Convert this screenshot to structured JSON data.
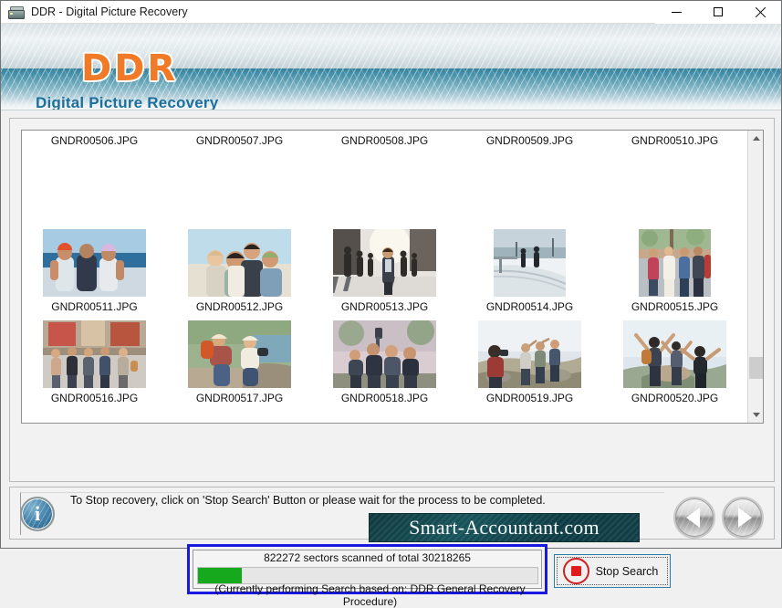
{
  "window": {
    "title": "DDR - Digital Picture Recovery",
    "icon": "drive-icon",
    "minimize_label": "—",
    "maximize_label": "□",
    "close_label": "✕"
  },
  "banner": {
    "logo": "DDR",
    "subtitle": "Digital Picture Recovery",
    "logo_color": "#f07a28",
    "subtitle_color": "#1c6f9c"
  },
  "file_grid": {
    "row1_captions": [
      "GNDR00506.JPG",
      "GNDR00507.JPG",
      "GNDR00508.JPG",
      "GNDR00509.JPG",
      "GNDR00510.JPG"
    ],
    "items": [
      {
        "caption": "GNDR00511.JPG",
        "scene": "beach-friends-backs"
      },
      {
        "caption": "GNDR00512.JPG",
        "scene": "group-selfie-sunny"
      },
      {
        "caption": "GNDR00513.JPG",
        "scene": "city-street-crowd"
      },
      {
        "caption": "GNDR00514.JPG",
        "scene": "snowy-path-walkers"
      },
      {
        "caption": "GNDR00515.JPG",
        "scene": "street-party-group"
      },
      {
        "caption": "GNDR00516.JPG",
        "scene": "friends-walking-town"
      },
      {
        "caption": "GNDR00517.JPG",
        "scene": "hikers-on-rock-lake"
      },
      {
        "caption": "GNDR00518.JPG",
        "scene": "friends-selfie-outdoors"
      },
      {
        "caption": "GNDR00519.JPG",
        "scene": "mountain-photo-group"
      },
      {
        "caption": "GNDR00520.JPG",
        "scene": "summit-arms-raised"
      }
    ],
    "scrollbar": {
      "up_arrow": "chevron-up",
      "down_arrow": "chevron-down",
      "thumb_position_percent": 88
    }
  },
  "progress": {
    "sectors_scanned": 822272,
    "sectors_total": 30218265,
    "label": "822272 sectors scanned of total 30218265",
    "note": "(Currently performing Search based on:  DDR General Recovery Procedure)",
    "percent": 13,
    "fill_color": "#16a91e",
    "border_color": "#1818e0"
  },
  "stop_button": {
    "label": "Stop Search",
    "icon": "stop-square-icon",
    "icon_color": "#e01c1c"
  },
  "status": {
    "icon": "info-icon",
    "message": "To Stop recovery, click on 'Stop Search' Button or please wait for the process to be completed."
  },
  "watermark": {
    "text": "Smart-Accountant.com"
  },
  "navigation": {
    "prev_icon": "triangle-left-icon",
    "next_icon": "triangle-right-icon"
  }
}
